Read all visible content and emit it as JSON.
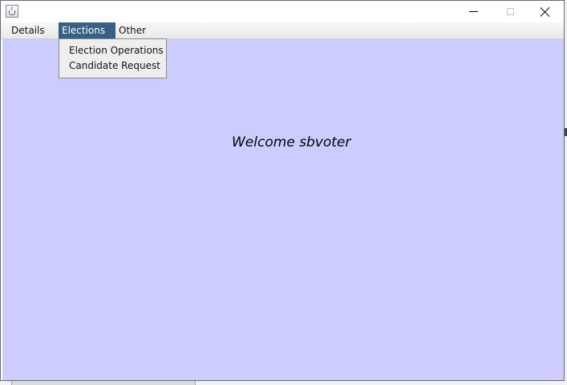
{
  "window": {
    "icon": "java-cup-icon",
    "controls": {
      "minimize": "minimize-icon",
      "maximize": "maximize-icon",
      "close": "close-icon"
    }
  },
  "menubar": {
    "items": [
      {
        "label": "Details"
      },
      {
        "label": "Elections"
      },
      {
        "label": "Other"
      }
    ],
    "active_color": "#385f85"
  },
  "dropdown": {
    "items": [
      {
        "label": "Election Operations"
      },
      {
        "label": "Candidate Request"
      }
    ]
  },
  "content": {
    "welcome": "Welcome sbvoter",
    "background_color": "#ccccff"
  }
}
